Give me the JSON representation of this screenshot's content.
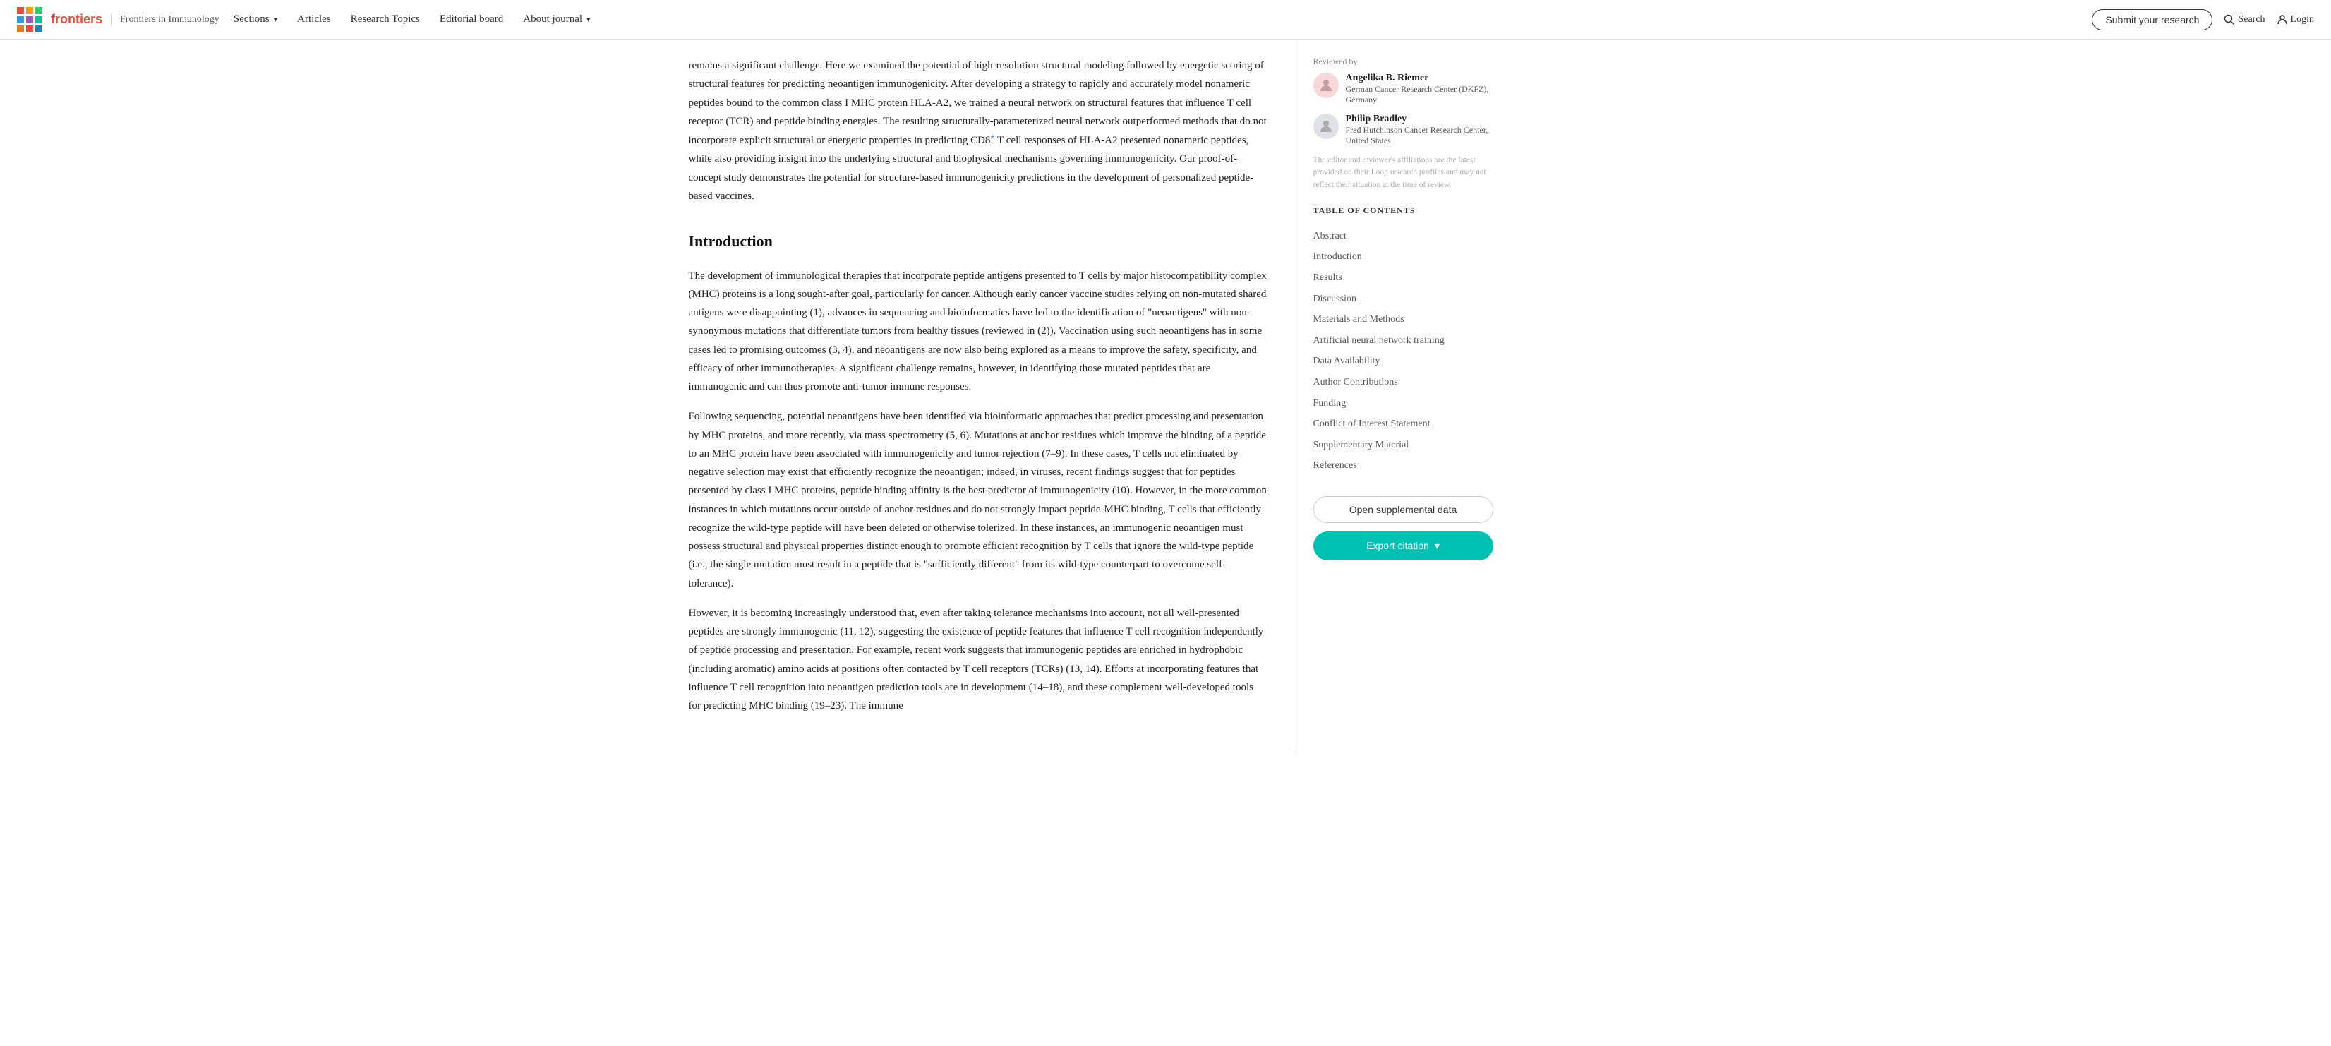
{
  "header": {
    "logo_alt": "Frontiers",
    "journal_name": "Frontiers in Immunology",
    "nav_items": [
      {
        "label": "Sections",
        "has_dropdown": true
      },
      {
        "label": "Articles",
        "has_dropdown": false
      },
      {
        "label": "Research Topics",
        "has_dropdown": false
      },
      {
        "label": "Editorial board",
        "has_dropdown": false
      },
      {
        "label": "About journal",
        "has_dropdown": true
      }
    ],
    "submit_label": "Submit your research",
    "search_label": "Search",
    "login_label": "Login"
  },
  "article": {
    "abstract_body_1": "remains a significant challenge. Here we examined the potential of high-resolution structural modeling followed by energetic scoring of structural features for predicting neoantigen immunogenicity. After developing a strategy to rapidly and accurately model nonameric peptides bound to the common class I MHC protein HLA-A2, we trained a neural network on structural features that influence T cell receptor (TCR) and peptide binding energies. The resulting structurally-parameterized neural network outperformed methods that do not incorporate explicit structural or energetic properties in predicting CD8",
    "abstract_superscript": "+",
    "abstract_body_2": " T cell responses of HLA-A2 presented nonameric peptides, while also providing insight into the underlying structural and biophysical mechanisms governing immunogenicity. Our proof-of-concept study demonstrates the potential for structure-based immunogenicity predictions in the development of personalized peptide-based vaccines.",
    "section_introduction": "Introduction",
    "intro_para_1": "The development of immunological therapies that incorporate peptide antigens presented to T cells by major histocompatibility complex (MHC) proteins is a long sought-after goal, particularly for cancer. Although early cancer vaccine studies relying on non-mutated shared antigens were disappointing (1), advances in sequencing and bioinformatics have led to the identification of \"neoantigens\" with non-synonymous mutations that differentiate tumors from healthy tissues (reviewed in (2)). Vaccination using such neoantigens has in some cases led to promising outcomes (3, 4), and neoantigens are now also being explored as a means to improve the safety, specificity, and efficacy of other immunotherapies. A significant challenge remains, however, in identifying those mutated peptides that are immunogenic and can thus promote anti-tumor immune responses.",
    "intro_para_2": "Following sequencing, potential neoantigens have been identified via bioinformatic approaches that predict processing and presentation by MHC proteins, and more recently, via mass spectrometry (5, 6). Mutations at anchor residues which improve the binding of a peptide to an MHC protein have been associated with immunogenicity and tumor rejection (7–9). In these cases, T cells not eliminated by negative selection may exist that efficiently recognize the neoantigen; indeed, in viruses, recent findings suggest that for peptides presented by class I MHC proteins, peptide binding affinity is the best predictor of immunogenicity (10). However, in the more common instances in which mutations occur outside of anchor residues and do not strongly impact peptide-MHC binding, T cells that efficiently recognize the wild-type peptide will have been deleted or otherwise tolerized. In these instances, an immunogenic neoantigen must possess structural and physical properties distinct enough to promote efficient recognition by T cells that ignore the wild-type peptide (i.e., the single mutation must result in a peptide that is \"sufficiently different\" from its wild-type counterpart to overcome self-tolerance).",
    "intro_para_3": "However, it is becoming increasingly understood that, even after taking tolerance mechanisms into account, not all well-presented peptides are strongly immunogenic (11, 12), suggesting the existence of peptide features that influence T cell recognition independently of peptide processing and presentation. For example, recent work suggests that immunogenic peptides are enriched in hydrophobic (including aromatic) amino acids at positions often contacted by T cell receptors (TCRs) (13, 14). Efforts at incorporating features that influence T cell recognition into neoantigen prediction tools are in development (14–18), and these complement well-developed tools for predicting MHC binding (19–23). The immune"
  },
  "sidebar": {
    "reviewer_label": "Reviewed by",
    "reviewers": [
      {
        "name": "Angelika B. Riemer",
        "institution": "German Cancer Research Center (DKFZ), Germany",
        "avatar_color": "pink"
      },
      {
        "name": "Philip Bradley",
        "institution": "Fred Hutchinson Cancer Research Center, United States",
        "avatar_color": "gray"
      }
    ],
    "editor_note": "The editor and reviewer's affiliations are the latest provided on their Loop research profiles and may not reflect their situation at the time of review.",
    "toc_label": "TABLE OF CONTENTS",
    "toc_items": [
      {
        "label": "Abstract",
        "active": false
      },
      {
        "label": "Introduction",
        "active": false
      },
      {
        "label": "Results",
        "active": false
      },
      {
        "label": "Discussion",
        "active": false
      },
      {
        "label": "Materials and Methods",
        "active": false
      },
      {
        "label": "Artificial neural network training",
        "active": false
      },
      {
        "label": "Data Availability",
        "active": false
      },
      {
        "label": "Author Contributions",
        "active": false
      },
      {
        "label": "Funding",
        "active": false
      },
      {
        "label": "Conflict of Interest Statement",
        "active": false
      },
      {
        "label": "Supplementary Material",
        "active": false
      },
      {
        "label": "References",
        "active": false
      }
    ],
    "open_supplemental_label": "Open supplemental data",
    "export_citation_label": "Export citation"
  }
}
